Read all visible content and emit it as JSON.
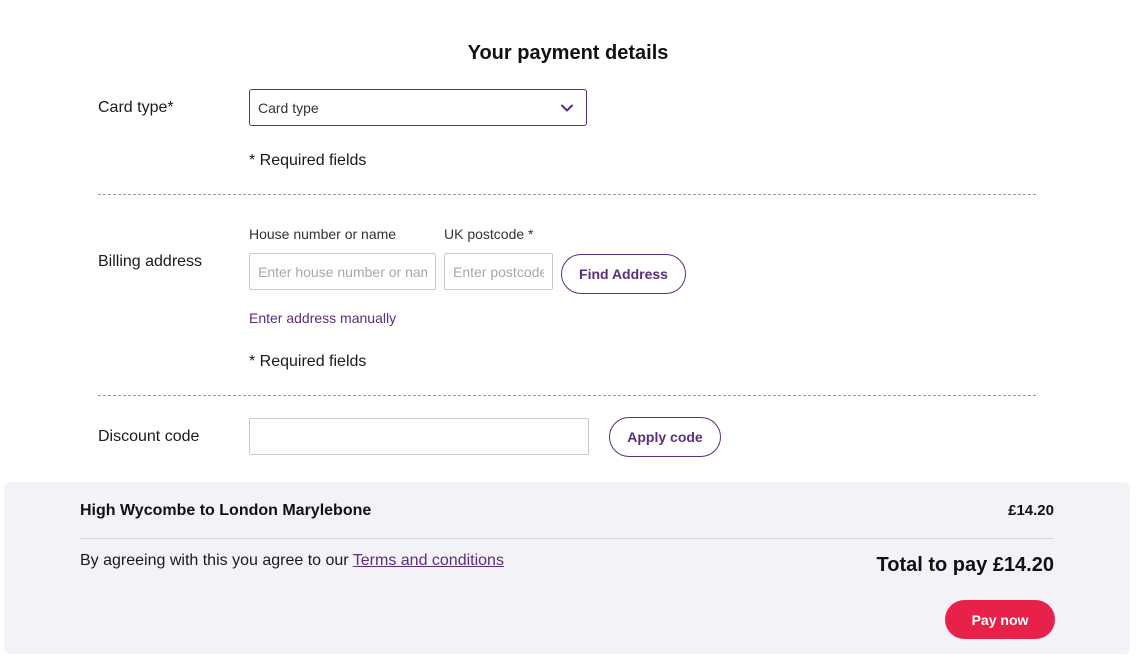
{
  "page": {
    "title": "Your payment details"
  },
  "card_type": {
    "label": "Card type*",
    "selected": "Card type",
    "required_note": "* Required fields"
  },
  "billing": {
    "label": "Billing address",
    "house_label": "House number or name",
    "house_placeholder": "Enter house number or name",
    "postcode_label": "UK postcode *",
    "postcode_placeholder": "Enter postcode",
    "find_button": "Find Address",
    "manual_link": "Enter address manually",
    "required_note": "* Required fields"
  },
  "discount": {
    "label": "Discount code",
    "value": "",
    "apply_button": "Apply code"
  },
  "summary": {
    "journey": "High Wycombe to London Marylebone",
    "price": "£14.20",
    "agree_text": "By agreeing with this you agree to our ",
    "terms_link": "Terms and conditions",
    "total": "Total to pay £14.20",
    "pay_button": "Pay now"
  },
  "colors": {
    "accent": "#5b2e7e",
    "pay": "#e8214b",
    "summary_bg": "#f3f2f7"
  },
  "icons": {
    "select_chevron": "chevron-down-icon"
  }
}
